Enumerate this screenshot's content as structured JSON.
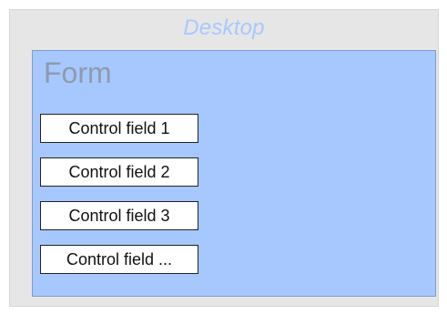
{
  "desktop": {
    "title": "Desktop"
  },
  "form": {
    "title": "Form",
    "fields": [
      "Control field 1",
      "Control field 2",
      "Control field 3",
      "Control field ..."
    ]
  },
  "colors": {
    "desktop_background": "#e6e6e6",
    "desktop_title": "#a9c8ff",
    "form_background": "#a6c8ff",
    "form_title": "#8f9bab",
    "field_background": "#ffffff"
  }
}
